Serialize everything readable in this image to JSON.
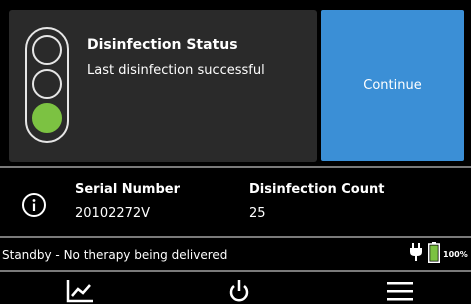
{
  "status": {
    "title": "Disinfection Status",
    "subtitle": "Last disinfection successful",
    "indicator": {
      "active_lamp": "bottom",
      "active_color": "#7cc242"
    }
  },
  "actions": {
    "continue_label": "Continue"
  },
  "device": {
    "serial_label": "Serial Number",
    "serial_value": "20102272V",
    "count_label": "Disinfection Count",
    "count_value": "25"
  },
  "status_bar": {
    "message": "Standby - No therapy being delivered",
    "battery_percent": "100%",
    "battery_level": 1.0,
    "icons": [
      "plug-icon",
      "battery-icon"
    ]
  },
  "nav": {
    "icons": [
      "trend-chart-icon",
      "power-icon",
      "menu-icon"
    ]
  },
  "colors": {
    "accent_blue": "#3b8fd6",
    "success_green": "#7cc242",
    "card_bg": "#2a2a2a",
    "background": "#000000"
  }
}
